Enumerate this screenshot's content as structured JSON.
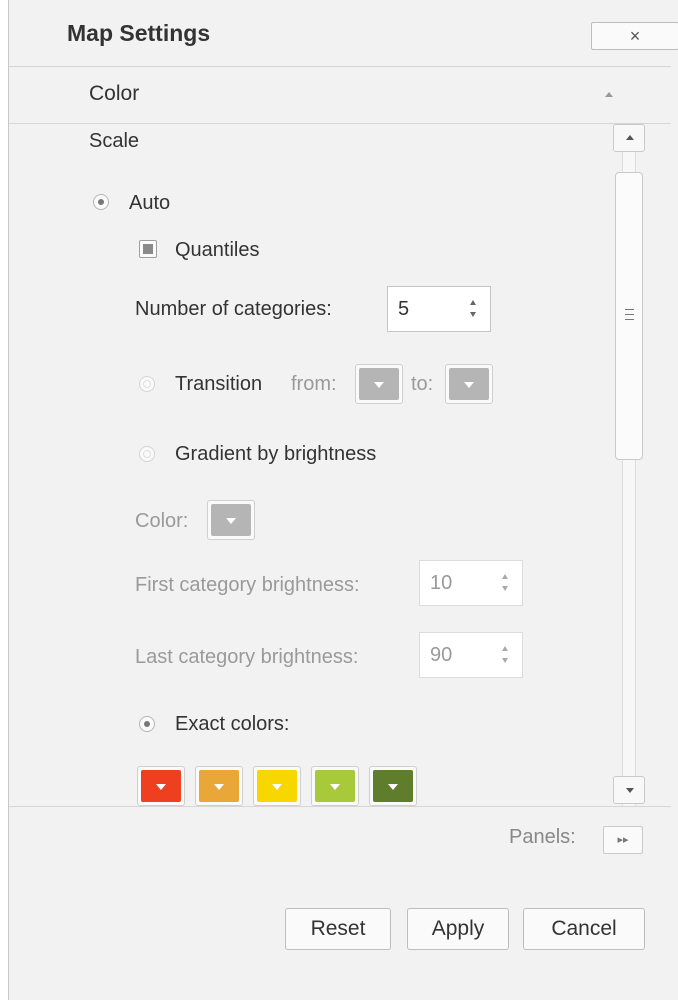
{
  "dialog": {
    "title": "Map Settings",
    "close_icon": "×"
  },
  "section": {
    "header": "Color"
  },
  "scale": {
    "heading": "Scale",
    "auto_label": "Auto",
    "quantiles_label": "Quantiles",
    "categories_label": "Number of categories:",
    "categories_value": "5",
    "transition_label": "Transition",
    "transition_from": "from:",
    "transition_to": "to:",
    "gradient_label": "Gradient by brightness",
    "color_label": "Color:",
    "first_brightness_label": "First category brightness:",
    "first_brightness_value": "10",
    "last_brightness_label": "Last category brightness:",
    "last_brightness_value": "90",
    "exact_label": "Exact colors:",
    "exact_colors": [
      "#ee4020",
      "#e8a736",
      "#f8d600",
      "#a8c93a",
      "#5f7d2a"
    ],
    "disabled_swatch_color": "#b5b5b5"
  },
  "footer": {
    "panels_label": "Panels:",
    "panels_icon": "▸▸",
    "reset": "Reset",
    "apply": "Apply",
    "cancel": "Cancel"
  },
  "colors": {
    "dialog_bg": "#f2f2f2",
    "text": "#333333",
    "disabled_text": "#9a9a9a"
  }
}
